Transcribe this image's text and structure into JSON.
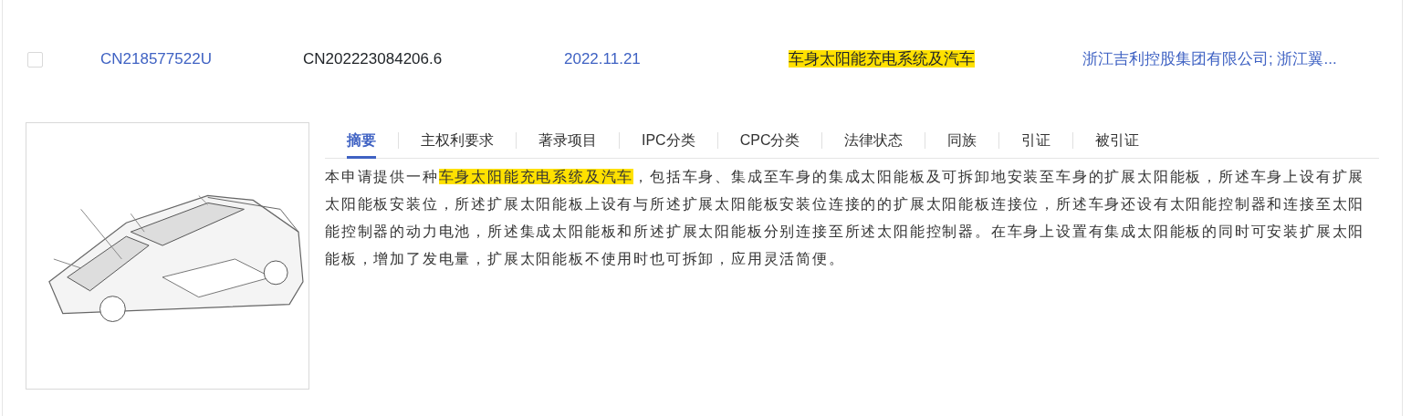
{
  "result_row": {
    "checkbox": {
      "checked": false
    },
    "publication_number": "CN218577522U",
    "application_number": "CN202223084206.6",
    "date": "2022.11.21",
    "title": {
      "text": "车身太阳能充电系统及汽车",
      "highlighted": true
    },
    "applicant": "浙江吉利控股集团有限公司; 浙江翼..."
  },
  "tabs": [
    {
      "label": "摘要",
      "selected": true
    },
    {
      "label": "主权利要求",
      "selected": false
    },
    {
      "label": "著录项目",
      "selected": false
    },
    {
      "label": "IPC分类",
      "selected": false
    },
    {
      "label": "CPC分类",
      "selected": false
    },
    {
      "label": "法律状态",
      "selected": false
    },
    {
      "label": "同族",
      "selected": false
    },
    {
      "label": "引证",
      "selected": false
    },
    {
      "label": "被引证",
      "selected": false
    }
  ],
  "abstract": [
    {
      "text": "本申请提供一种",
      "highlighted": false
    },
    {
      "text": "车身太阳能充电系统及汽车",
      "highlighted": true
    },
    {
      "text": "，包括车身、集成至车身的集成太阳能板及可拆卸地安装至车身的扩展太阳能板，所述车身上设有扩展太阳能板安装位，所述扩展太阳能板上设有与所述扩展太阳能板安装位连接的的扩展太阳能板连接位，所述车身还设有太阳能控制器和连接至太阳能控制器的动力电池，所述集成太阳能板和所述扩展太阳能板分别连接至所述太阳能控制器。在车身上设置有集成太阳能板的同时可安装扩展太阳能板，增加了发电量，扩展太阳能板不使用时也可拆卸，应用灵活简便。",
      "highlighted": false
    }
  ]
}
